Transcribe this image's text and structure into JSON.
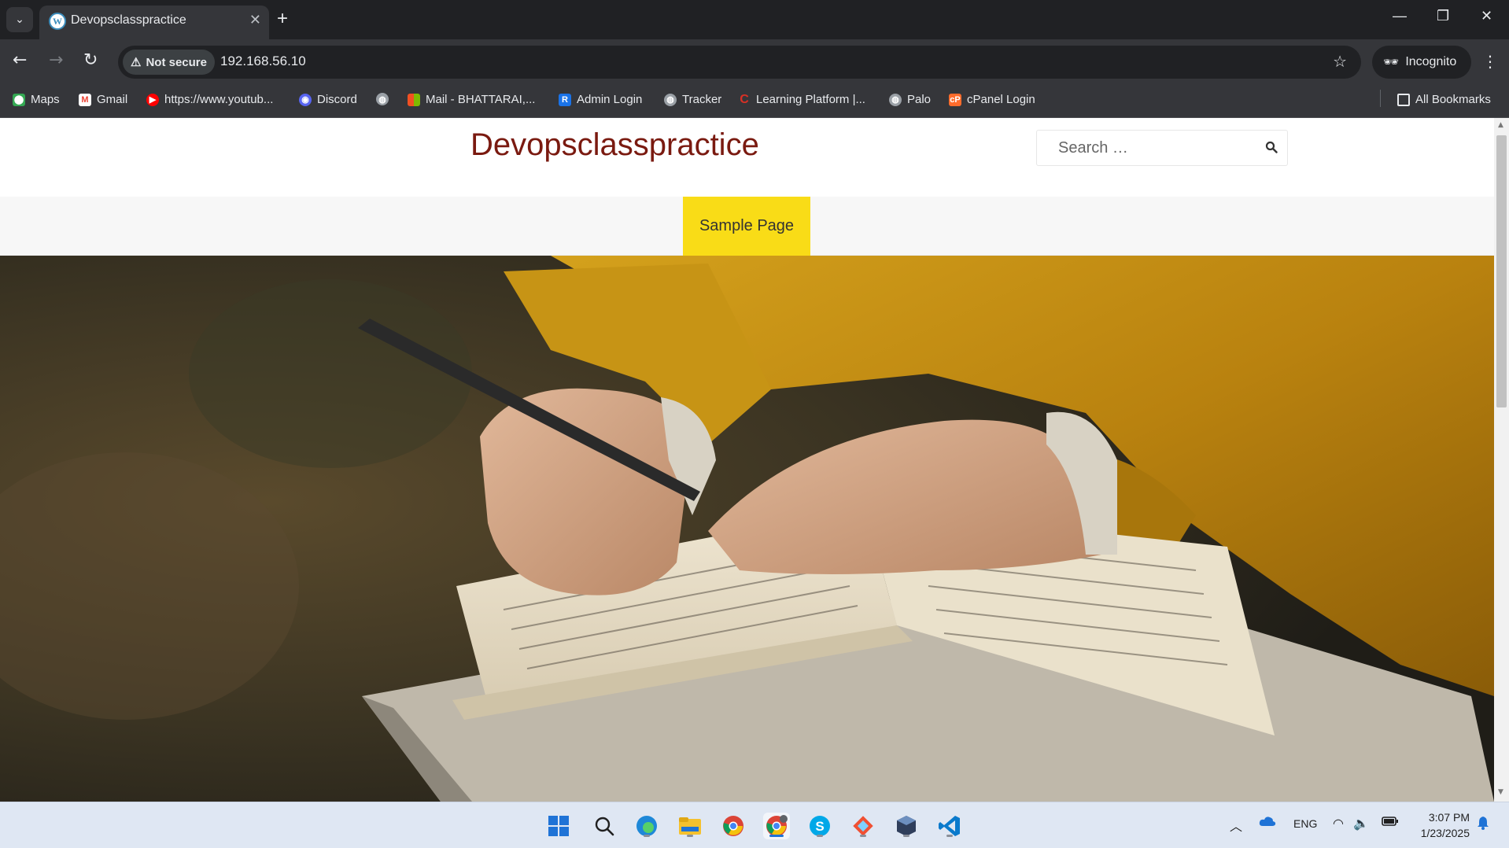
{
  "browser": {
    "tab": {
      "title": "Devopsclasspractice",
      "favicon": "wordpress-icon"
    },
    "address": {
      "security_label": "Not secure",
      "url": "192.168.56.10"
    },
    "profile_label": "Incognito",
    "bookmarks": [
      {
        "label": "Maps",
        "icon": "maps-icon"
      },
      {
        "label": "Gmail",
        "icon": "gmail-icon"
      },
      {
        "label": "https://www.youtub...",
        "icon": "youtube-icon"
      },
      {
        "label": "Discord",
        "icon": "discord-icon"
      },
      {
        "label": "",
        "icon": "globe-icon"
      },
      {
        "label": "Mail - BHATTARAI,...",
        "icon": "microsoft-icon"
      },
      {
        "label": "Admin Login",
        "icon": "admin-icon"
      },
      {
        "label": "Tracker",
        "icon": "globe-icon"
      },
      {
        "label": "Learning Platform |...",
        "icon": "learning-icon"
      },
      {
        "label": "Palo",
        "icon": "globe-icon"
      },
      {
        "label": "cPanel Login",
        "icon": "cpanel-icon"
      }
    ],
    "all_bookmarks_label": "All Bookmarks"
  },
  "site": {
    "title": "Devopsclasspractice",
    "search_placeholder": "Search …",
    "nav": [
      {
        "label": "Sample Page"
      }
    ],
    "accent_color": "#f9dc17",
    "title_color": "#7a1a10"
  },
  "taskbar": {
    "apps": [
      "windows-start-icon",
      "search-icon",
      "edge-icon",
      "file-explorer-icon",
      "chrome-icon",
      "chrome-incognito-icon",
      "skype-icon",
      "git-icon",
      "virtualbox-icon",
      "vscode-icon"
    ],
    "language": "ENG",
    "time": "3:07 PM",
    "date": "1/23/2025"
  }
}
